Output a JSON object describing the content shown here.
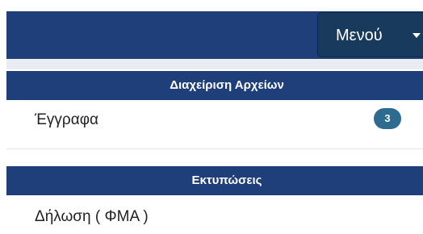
{
  "navbar": {
    "menu_label": "Μενού"
  },
  "files_section": {
    "title": "Διαχείριση Αρχείων",
    "items": [
      {
        "label": "Έγγραφα",
        "badge": "3"
      }
    ]
  },
  "prints_section": {
    "title": "Εκτυπώσεις",
    "items": [
      {
        "label": "Δήλωση ( ΦΜΑ )"
      }
    ]
  },
  "colors": {
    "navbar": "#1f3f7a",
    "menu_button": "#183a5d",
    "badge": "#2e6b91"
  }
}
